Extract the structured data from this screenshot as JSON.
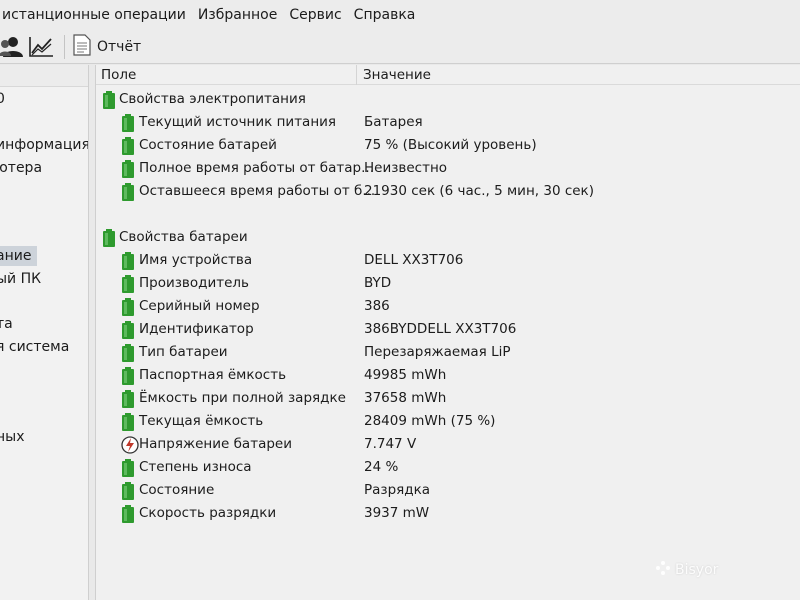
{
  "menu": {
    "items": [
      "истанционные операции",
      "Избранное",
      "Сервис",
      "Справка"
    ]
  },
  "toolbar": {
    "report_label": "Отчёт"
  },
  "left_tree": {
    "items": [
      {
        "label": "0",
        "selected": false
      },
      {
        "label": "информация",
        "selected": false
      },
      {
        "label": "ютера",
        "selected": false
      },
      {
        "label": "ание",
        "selected": true
      },
      {
        "label": "ый ПК",
        "selected": false
      },
      {
        "label": "та",
        "selected": false
      },
      {
        "label": "я система",
        "selected": false
      },
      {
        "label": "ных",
        "selected": false
      }
    ]
  },
  "table": {
    "col_field": "Поле",
    "col_value": "Значение",
    "sections": [
      {
        "title": "Свойства электропитания",
        "rows": [
          {
            "field": "Текущий источник питания",
            "value": "Батарея",
            "icon": "battery-icon"
          },
          {
            "field": "Состояние батарей",
            "value": "75 % (Высокий уровень)",
            "icon": "battery-icon"
          },
          {
            "field": "Полное время работы от батар...",
            "value": "Неизвестно",
            "icon": "battery-icon"
          },
          {
            "field": "Оставшееся время работы от б...",
            "value": "21930 сек (6 час., 5 мин, 30 сек)",
            "icon": "battery-icon"
          }
        ]
      },
      {
        "title": "Свойства батареи",
        "rows": [
          {
            "field": "Имя устройства",
            "value": "DELL XX3T706",
            "icon": "battery-icon"
          },
          {
            "field": "Производитель",
            "value": "BYD",
            "icon": "battery-icon"
          },
          {
            "field": "Серийный номер",
            "value": "386",
            "icon": "battery-icon"
          },
          {
            "field": "Идентификатор",
            "value": "386BYDDELL XX3T706",
            "icon": "battery-icon"
          },
          {
            "field": "Тип батареи",
            "value": "Перезаряжаемая LiP",
            "icon": "battery-icon"
          },
          {
            "field": "Паспортная ёмкость",
            "value": "49985 mWh",
            "icon": "battery-icon"
          },
          {
            "field": "Ёмкость при полной зарядке",
            "value": "37658 mWh",
            "icon": "battery-icon"
          },
          {
            "field": "Текущая ёмкость",
            "value": "28409 mWh  (75 %)",
            "icon": "battery-icon"
          },
          {
            "field": "Напряжение батареи",
            "value": "7.747 V",
            "icon": "voltage-icon"
          },
          {
            "field": "Степень износа",
            "value": "24 %",
            "icon": "battery-icon"
          },
          {
            "field": "Состояние",
            "value": "Разрядка",
            "icon": "battery-icon"
          },
          {
            "field": "Скорость разрядки",
            "value": "3937 mW",
            "icon": "battery-icon"
          }
        ]
      }
    ]
  },
  "watermark": "Bisyor",
  "colors": {
    "battery_green": "#2e9a2e",
    "voltage_red": "#c0392b",
    "selected_bg": "#cdd3da"
  }
}
